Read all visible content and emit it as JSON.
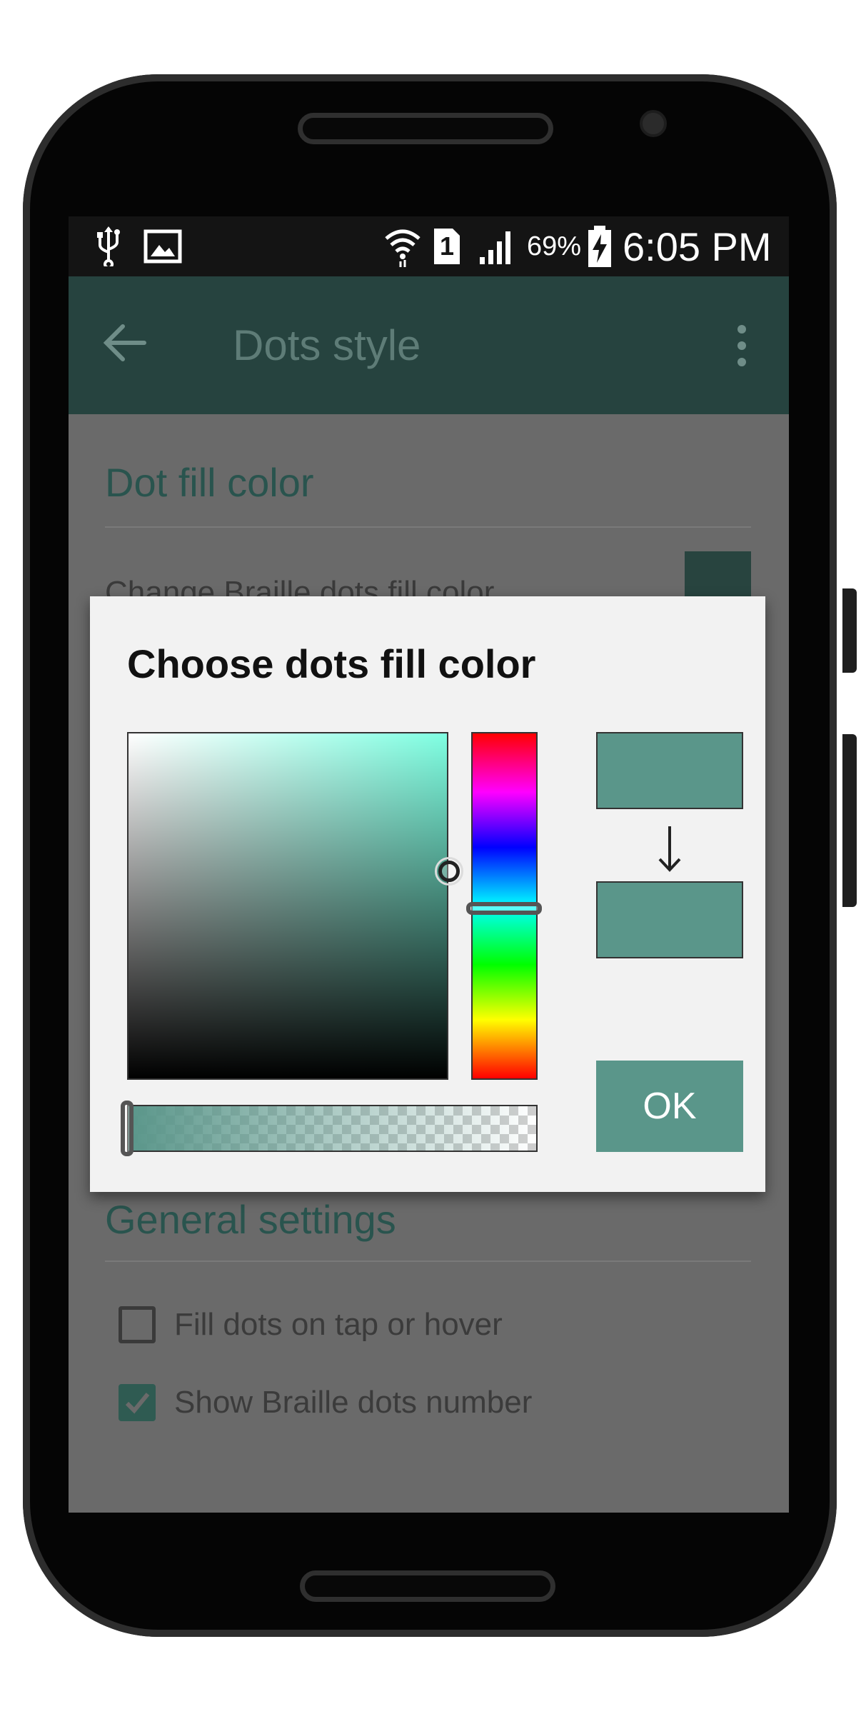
{
  "status_bar": {
    "battery_percent": "69%",
    "time": "6:05 PM",
    "sim_slot": "1",
    "icons": [
      "usb-icon",
      "image-icon",
      "wifi-icon",
      "sim-icon",
      "signal-icon",
      "battery-charging-icon"
    ]
  },
  "app_bar": {
    "title": "Dots style",
    "back_icon": "arrow-left-icon",
    "menu_icon": "more-vert-icon"
  },
  "settings": {
    "dot_fill_section_title": "Dot fill color",
    "change_fill_label": "Change Braille dots fill color",
    "general_section_title": "General settings",
    "checkboxes": [
      {
        "label": "Fill dots on tap or hover",
        "checked": false
      },
      {
        "label": "Show Braille dots number",
        "checked": true
      }
    ]
  },
  "dialog": {
    "title": "Choose dots fill color",
    "ok_label": "OK",
    "old_color": "#5a968a",
    "new_color": "#5a968a",
    "arrow_icon": "arrow-down-icon"
  },
  "colors": {
    "accent": "#5a968a",
    "app_bar": "#26433f",
    "section_title": "#29544e"
  }
}
